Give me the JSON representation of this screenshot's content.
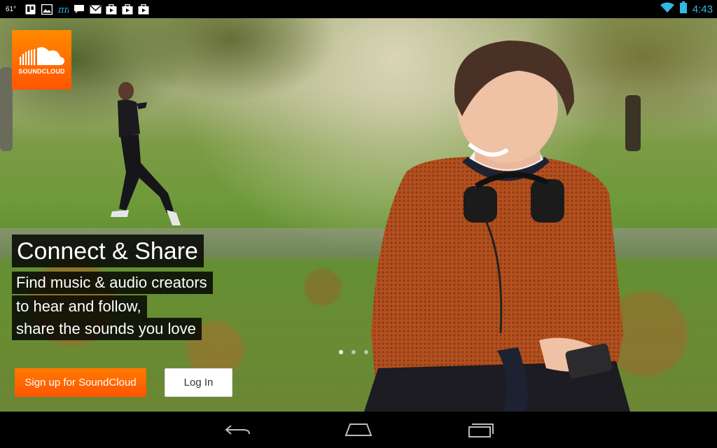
{
  "statusbar": {
    "temperature": "61°",
    "left_icons": [
      "trello-icon",
      "image-icon",
      "pi-icon",
      "chat-icon",
      "mail-icon",
      "briefcase-icon",
      "briefcase-icon",
      "briefcase-icon"
    ],
    "time": "4:43",
    "colors": {
      "time": "#33b5e5",
      "wifi": "#33b5e5",
      "battery": "#33b5e5"
    }
  },
  "logo": {
    "text": "SOUNDCLOUD",
    "color": "#ff5500"
  },
  "hero": {
    "headline": "Connect & Share",
    "lines": [
      "Find music & audio creators",
      "to hear and follow,",
      "share the sounds you love"
    ],
    "pager": {
      "count": 3,
      "active": 0
    }
  },
  "actions": {
    "signup_label": "Sign up for SoundCloud",
    "login_label": "Log In"
  },
  "navbar": {
    "icons": [
      "back-icon",
      "home-icon",
      "recent-apps-icon"
    ]
  }
}
